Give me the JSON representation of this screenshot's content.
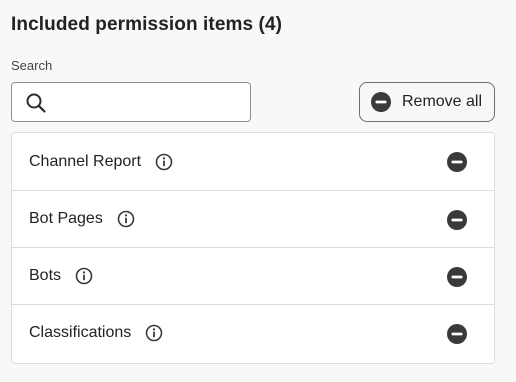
{
  "heading": "Included permission items (4)",
  "search": {
    "label": "Search",
    "value": "",
    "placeholder": "",
    "icon": "search-icon"
  },
  "remove_all": {
    "label": "Remove all",
    "icon": "remove-circle-icon"
  },
  "items": [
    {
      "label": "Channel Report",
      "info_icon": "info-icon",
      "remove_icon": "remove-circle-icon"
    },
    {
      "label": "Bot Pages",
      "info_icon": "info-icon",
      "remove_icon": "remove-circle-icon"
    },
    {
      "label": "Bots",
      "info_icon": "info-icon",
      "remove_icon": "remove-circle-icon"
    },
    {
      "label": "Classifications",
      "info_icon": "info-icon",
      "remove_icon": "remove-circle-icon"
    }
  ],
  "colors": {
    "background": "#f8f8f8",
    "text": "#222222",
    "icon_dark": "#3a3a3a",
    "border": "#dcdcdc"
  }
}
